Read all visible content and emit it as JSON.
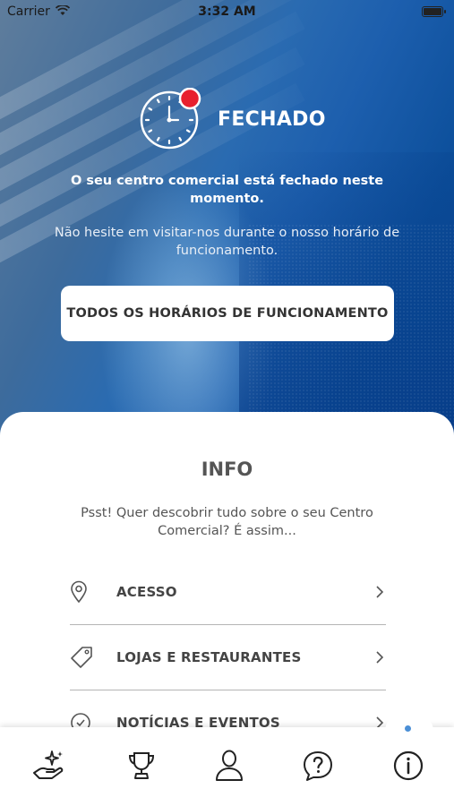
{
  "status_bar": {
    "carrier": "Carrier",
    "time": "3:32 AM"
  },
  "closed": {
    "title": "FECHADO",
    "message_bold": "O seu centro comercial está fechado neste momento.",
    "message": "Não hesite em visitar-nos durante o nosso horário de funcionamento.",
    "hours_button": "TODOS OS HORÁRIOS DE FUNCIONAMENTO"
  },
  "info": {
    "title": "INFO",
    "subtitle": "Psst! Quer descobrir tudo sobre o seu Centro Comercial? É assim...",
    "items": [
      {
        "label": "ACESSO",
        "icon": "location-pin-icon"
      },
      {
        "label": "LOJAS E RESTAURANTES",
        "icon": "tag-icon"
      },
      {
        "label": "NOTÍCIAS E EVENTOS",
        "icon": "news-icon"
      }
    ]
  },
  "tabbar": {
    "tabs": [
      "offers-hand-icon",
      "trophy-icon",
      "profile-icon",
      "help-icon",
      "info-icon"
    ],
    "active": "info-icon"
  },
  "colors": {
    "accent_red": "#e8202e",
    "brand_blue": "#0b4d97",
    "active_dot": "#4b8fd6"
  }
}
